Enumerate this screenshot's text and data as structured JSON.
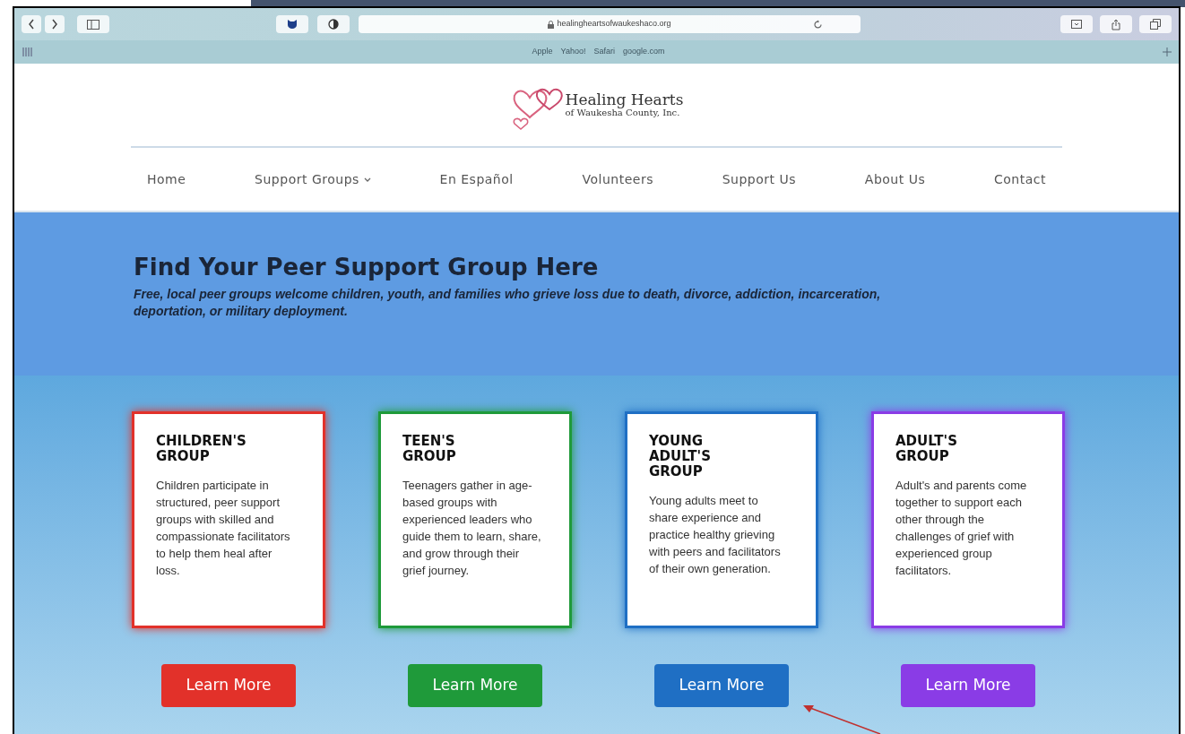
{
  "browser": {
    "url": "healingheartsofwaukeshaco.org",
    "bookmarks": [
      "Apple",
      "Yahoo!",
      "Safari",
      "google.com"
    ]
  },
  "logo": {
    "name": "Healing Hearts",
    "subtitle": "of Waukesha County, Inc."
  },
  "nav": [
    {
      "label": "Home",
      "dropdown": false
    },
    {
      "label": "Support Groups",
      "dropdown": true
    },
    {
      "label": "En Español",
      "dropdown": false
    },
    {
      "label": "Volunteers",
      "dropdown": false
    },
    {
      "label": "Support Us",
      "dropdown": false
    },
    {
      "label": "About Us",
      "dropdown": false
    },
    {
      "label": "Contact",
      "dropdown": false
    }
  ],
  "hero": {
    "title": "Find Your Peer Support Group Here",
    "subtitle": "Free, local peer groups welcome children, youth, and families who grieve loss due to death, divorce, addiction, incarceration, deportation, or military deployment."
  },
  "cards": [
    {
      "title": "CHILDREN'S\nGROUP",
      "text": "Children participate in structured, peer support groups with skilled and compassionate facilitators to help them heal after loss.",
      "color": "#e2312a",
      "button": "Learn More"
    },
    {
      "title": "TEEN'S\nGROUP",
      "text": "Teenagers gather in age-based groups with experienced leaders who guide them to learn, share, and grow through their grief journey.",
      "color": "#1f9a3a",
      "button": "Learn More"
    },
    {
      "title": "YOUNG\nADULT'S\nGROUP",
      "text": "Young adults meet to share experience and practice healthy grieving with peers and facilitators of their own generation.",
      "color": "#1f6fc4",
      "button": "Learn More"
    },
    {
      "title": "ADULT'S\nGROUP",
      "text": "Adult's and parents come together to support each other through the challenges of grief with experienced group facilitators.",
      "color": "#8a3ce6",
      "button": "Learn More"
    }
  ]
}
